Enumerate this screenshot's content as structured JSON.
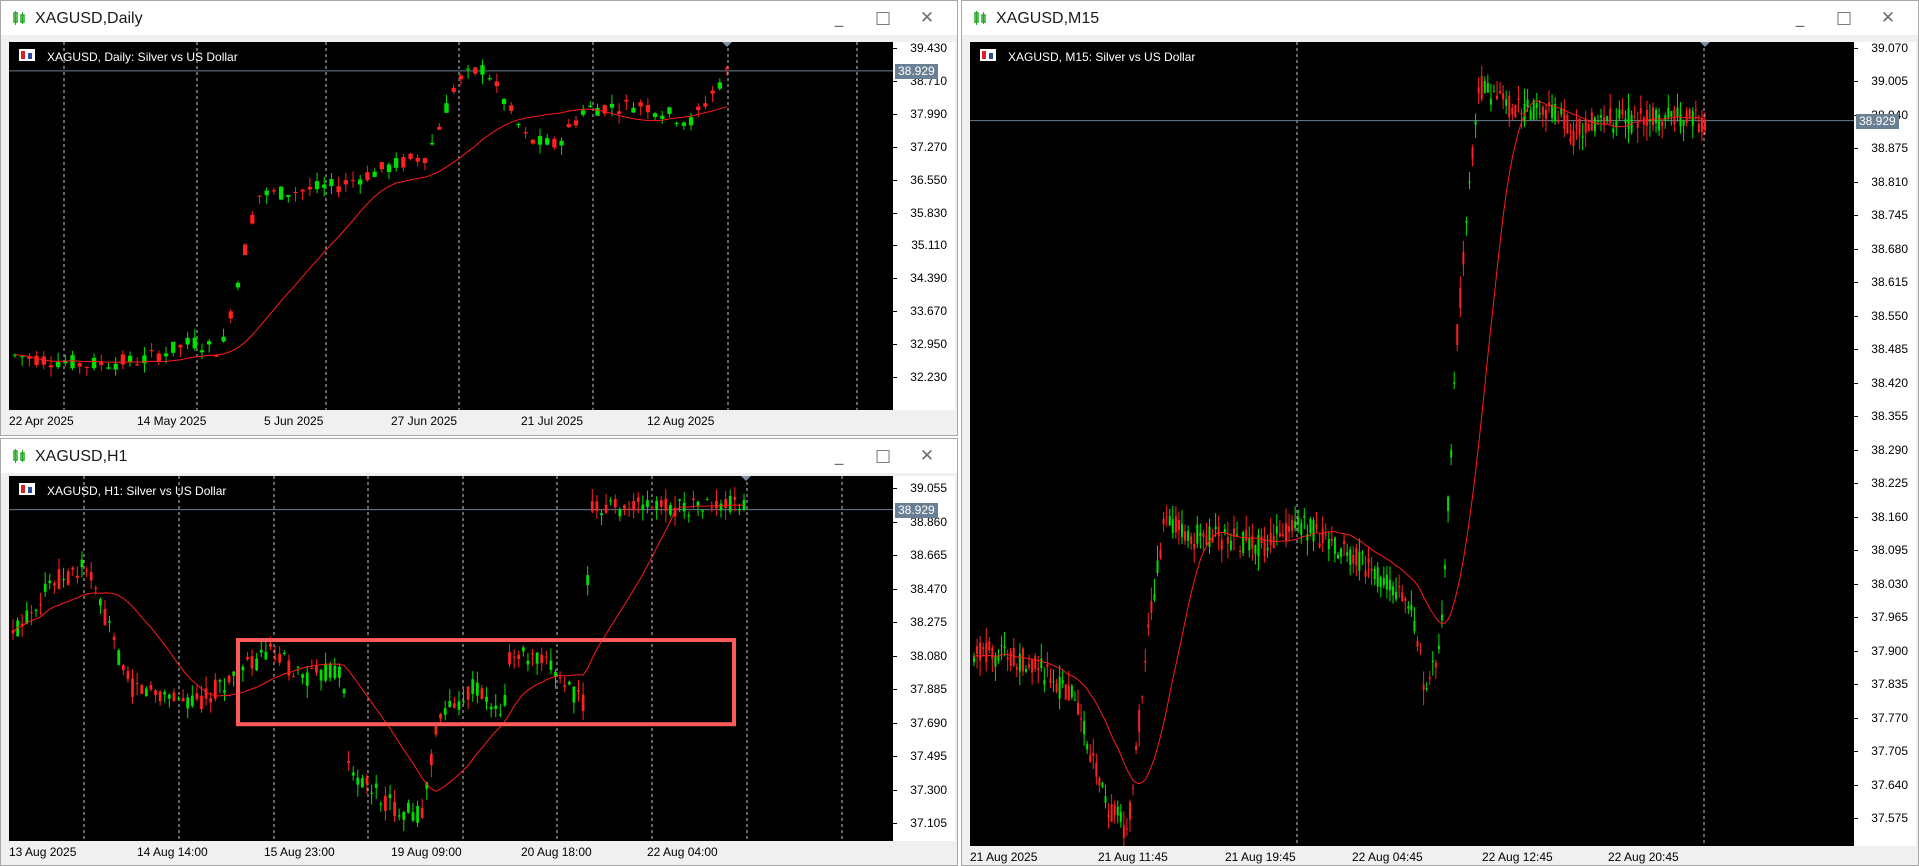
{
  "windows": {
    "daily": {
      "title": "XAGUSD,Daily",
      "label": "XAGUSD, Daily:  Silver vs US Dollar",
      "price_badge": "38.929",
      "y_labels": [
        "39.430",
        "38.710",
        "37.990",
        "37.270",
        "36.550",
        "35.830",
        "35.110",
        "34.390",
        "33.670",
        "32.950",
        "32.230"
      ],
      "x_labels": [
        "22 Apr 2025",
        "14 May 2025",
        "5 Jun 2025",
        "27 Jun 2025",
        "21 Jul 2025",
        "12 Aug 2025"
      ]
    },
    "h1": {
      "title": "XAGUSD,H1",
      "label": "XAGUSD, H1:  Silver vs US Dollar",
      "price_badge": "38.929",
      "y_labels": [
        "39.055",
        "38.860",
        "38.665",
        "38.470",
        "38.275",
        "38.080",
        "37.885",
        "37.690",
        "37.495",
        "37.300",
        "37.105"
      ],
      "x_labels": [
        "13 Aug 2025",
        "14 Aug 14:00",
        "15 Aug 23:00",
        "19 Aug 09:00",
        "20 Aug 18:00",
        "22 Aug 04:00"
      ]
    },
    "m15": {
      "title": "XAGUSD,M15",
      "label": "XAGUSD, M15:  Silver vs US Dollar",
      "price_badge": "38.929",
      "y_labels": [
        "39.070",
        "39.005",
        "38.940",
        "38.875",
        "38.810",
        "38.745",
        "38.680",
        "38.615",
        "38.550",
        "38.485",
        "38.420",
        "38.355",
        "38.290",
        "38.225",
        "38.160",
        "38.095",
        "38.030",
        "37.965",
        "37.900",
        "37.835",
        "37.770",
        "37.705",
        "37.640",
        "37.575"
      ],
      "x_labels": [
        "21 Aug 2025",
        "21 Aug 11:45",
        "21 Aug 19:45",
        "22 Aug 04:45",
        "22 Aug 12:45",
        "22 Aug 20:45"
      ]
    }
  },
  "window_controls": {
    "minimize": "_",
    "maximize": "□",
    "close": "✕"
  },
  "colors": {
    "bull": "#00e000",
    "bear": "#ff2020",
    "ma": "#ff1a1a",
    "grid": "#c8c8c8",
    "highlight": "#ff5a5a",
    "price_line": "#6b7f94"
  }
}
